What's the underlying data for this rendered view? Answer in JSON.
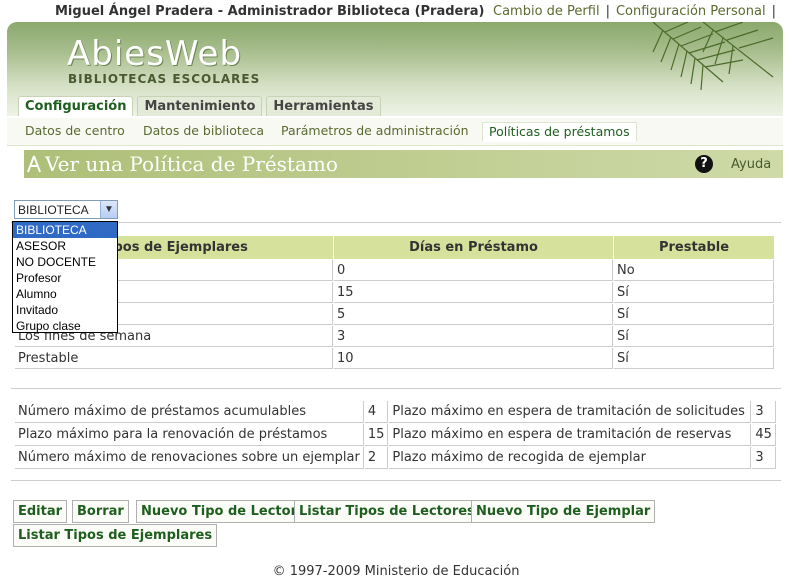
{
  "header": {
    "user": "Miguel Ángel Pradera - Administrador Biblioteca (Pradera)",
    "links": [
      "Cambio de Perfil",
      "Configuración Personal"
    ]
  },
  "logo": {
    "main": "AbiesWeb",
    "sub": "BIBLIOTECAS ESCOLARES"
  },
  "tabs": [
    "Configuración",
    "Mantenimiento",
    "Herramientas"
  ],
  "subnav": [
    "Datos de centro",
    "Datos de biblioteca",
    "Parámetros de administración",
    "Políticas de préstamos"
  ],
  "page": {
    "title": "Ver una Política de Préstamo",
    "help": "Ayuda"
  },
  "reader_select": {
    "value": "BIBLIOTECA",
    "options": [
      "BIBLIOTECA",
      "ASESOR",
      "NO DOCENTE",
      "Profesor",
      "Alumno",
      "Invitado",
      "Grupo clase"
    ]
  },
  "policy_table": {
    "headers": [
      "Tipos de Ejemplares",
      "Días en Préstamo",
      "Prestable"
    ],
    "header_visible_part": "pos de Ejemplares",
    "rows": [
      [
        "",
        "0",
        "No"
      ],
      [
        "",
        "15",
        "Sí"
      ],
      [
        "",
        "5",
        "Sí"
      ],
      [
        "Los fines de semana",
        "3",
        "Sí"
      ],
      [
        "Prestable",
        "10",
        "Sí"
      ]
    ]
  },
  "limits": [
    [
      "Número máximo de préstamos acumulables",
      "4",
      "Plazo máximo en espera de tramitación de solicitudes",
      "3"
    ],
    [
      "Plazo máximo para la renovación de préstamos",
      "15",
      "Plazo máximo en espera de tramitación de reservas",
      "45"
    ],
    [
      "Número máximo de renovaciones sobre un ejemplar",
      "2",
      "Plazo máximo de recogida de ejemplar",
      "3"
    ]
  ],
  "buttons": [
    "Editar",
    "Borrar",
    "Nuevo Tipo de Lector",
    "Listar Tipos de Lectores",
    "Nuevo Tipo de Ejemplar",
    "Listar Tipos de Ejemplares"
  ],
  "footer": "© 1997-2009 Ministerio de Educación",
  "colors": {
    "accent": "#1e5e1e",
    "header_bg": "#d6e19b",
    "banner": "#a7bd8c",
    "selected": "#316ac5"
  },
  "icons": [
    "abies-logo-icon",
    "help-icon",
    "dropdown-arrow-icon",
    "pine-branch-icon"
  ]
}
